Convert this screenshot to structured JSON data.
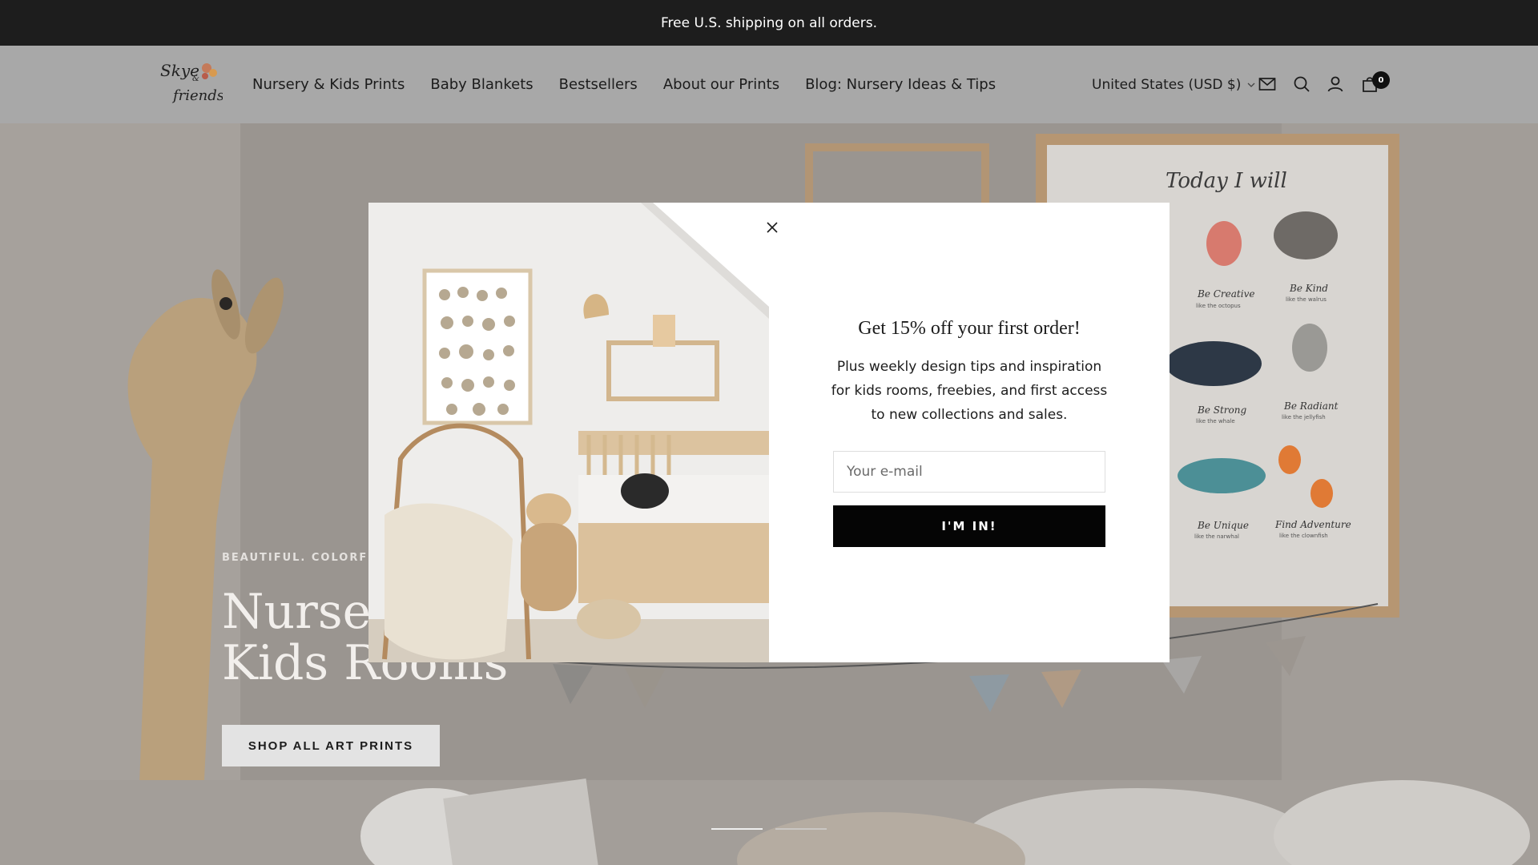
{
  "announcement": {
    "text": "Free U.S. shipping on all orders."
  },
  "header": {
    "logo": {
      "text_line1": "Skye",
      "text_line2": "&",
      "text_line3": "friends"
    },
    "nav": [
      {
        "label": "Nursery & Kids Prints"
      },
      {
        "label": "Baby Blankets"
      },
      {
        "label": "Bestsellers"
      },
      {
        "label": "About our Prints"
      },
      {
        "label": "Blog: Nursery Ideas & Tips"
      }
    ],
    "locale": "United States (USD $)",
    "icons": [
      "mail-icon",
      "search-icon",
      "account-icon",
      "cart-icon"
    ],
    "cart_count": "0"
  },
  "hero": {
    "eyebrow": "BEAUTIFUL. COLORFUL. M",
    "title_line1": "Nursery",
    "title_line2": "Kids Rooms",
    "button_label": "SHOP ALL ART PRINTS",
    "slides": 2,
    "active_slide": 1
  },
  "popup": {
    "title": "Get 15% off your first order!",
    "text": "Plus weekly design tips and inspiration for kids rooms, freebies, and first access to new collections and sales.",
    "email_placeholder": "Your e-mail",
    "submit_label": "I'M IN!"
  },
  "poster": {
    "heading": "Today I will",
    "items": [
      {
        "caption": "Be Creative",
        "sub": "like the octopus"
      },
      {
        "caption": "Be Kind",
        "sub": "like the walrus"
      },
      {
        "caption": "Be Strong",
        "sub": "like the whale"
      },
      {
        "caption": "Be Radiant",
        "sub": "like the jellyfish"
      },
      {
        "caption": "Be Unique",
        "sub": "like the narwhal"
      },
      {
        "caption": "Find Adventure",
        "sub": "like the clownfish"
      }
    ]
  },
  "colors": {
    "announcement_bg": "#1d1d1d",
    "header_bg": "#a8a8a8",
    "button_black": "#050505",
    "hero_button_bg": "#e3e3e3"
  }
}
